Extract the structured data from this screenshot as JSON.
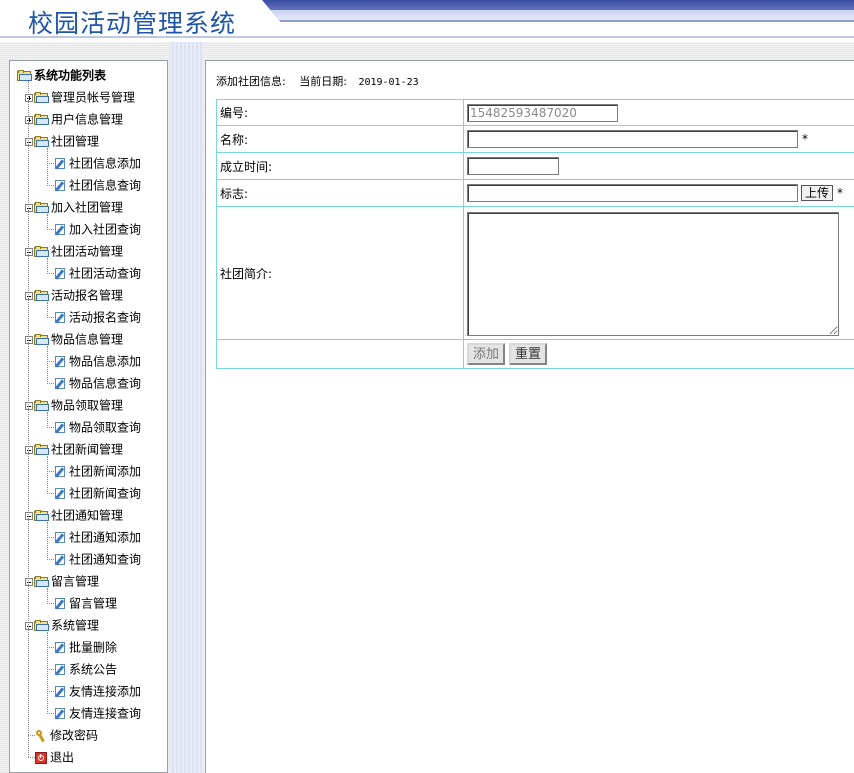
{
  "app": {
    "title": "校园活动管理系统"
  },
  "sidebar": {
    "root_label": "系统功能列表",
    "groups": [
      {
        "label": "管理员帐号管理",
        "expander": "plus",
        "children": []
      },
      {
        "label": "用户信息管理",
        "expander": "plus",
        "children": []
      },
      {
        "label": "社团管理",
        "expander": "minus",
        "children": [
          "社团信息添加",
          "社团信息查询"
        ]
      },
      {
        "label": "加入社团管理",
        "expander": "minus",
        "children": [
          "加入社团查询"
        ]
      },
      {
        "label": "社团活动管理",
        "expander": "minus",
        "children": [
          "社团活动查询"
        ]
      },
      {
        "label": "活动报名管理",
        "expander": "minus",
        "children": [
          "活动报名查询"
        ]
      },
      {
        "label": "物品信息管理",
        "expander": "minus",
        "children": [
          "物品信息添加",
          "物品信息查询"
        ]
      },
      {
        "label": "物品领取管理",
        "expander": "minus",
        "children": [
          "物品领取查询"
        ]
      },
      {
        "label": "社团新闻管理",
        "expander": "minus",
        "children": [
          "社团新闻添加",
          "社团新闻查询"
        ]
      },
      {
        "label": "社团通知管理",
        "expander": "minus",
        "children": [
          "社团通知添加",
          "社团通知查询"
        ]
      },
      {
        "label": "留言管理",
        "expander": "minus",
        "children": [
          "留言管理"
        ]
      },
      {
        "label": "系统管理",
        "expander": "minus",
        "children": [
          "批量删除",
          "系统公告",
          "友情连接添加",
          "友情连接查询"
        ]
      }
    ],
    "change_password": "修改密码",
    "logout": "退出"
  },
  "content": {
    "heading": "添加社团信息:",
    "date_label": "当前日期:",
    "date_value": "2019-01-23",
    "form": {
      "id_label": "编号:",
      "id_value": "15482593487020",
      "name_label": "名称:",
      "name_value": "",
      "founded_label": "成立时间:",
      "founded_value": "",
      "logo_label": "标志:",
      "logo_value": "",
      "upload_label": "上传",
      "required_mark": "*",
      "intro_label": "社团简介:",
      "intro_value": "",
      "add_label": "添加",
      "reset_label": "重置"
    }
  },
  "colors": {
    "title": "#1f55a8",
    "table_border": "#7ad6e0",
    "header_band": "#3b4da0"
  }
}
